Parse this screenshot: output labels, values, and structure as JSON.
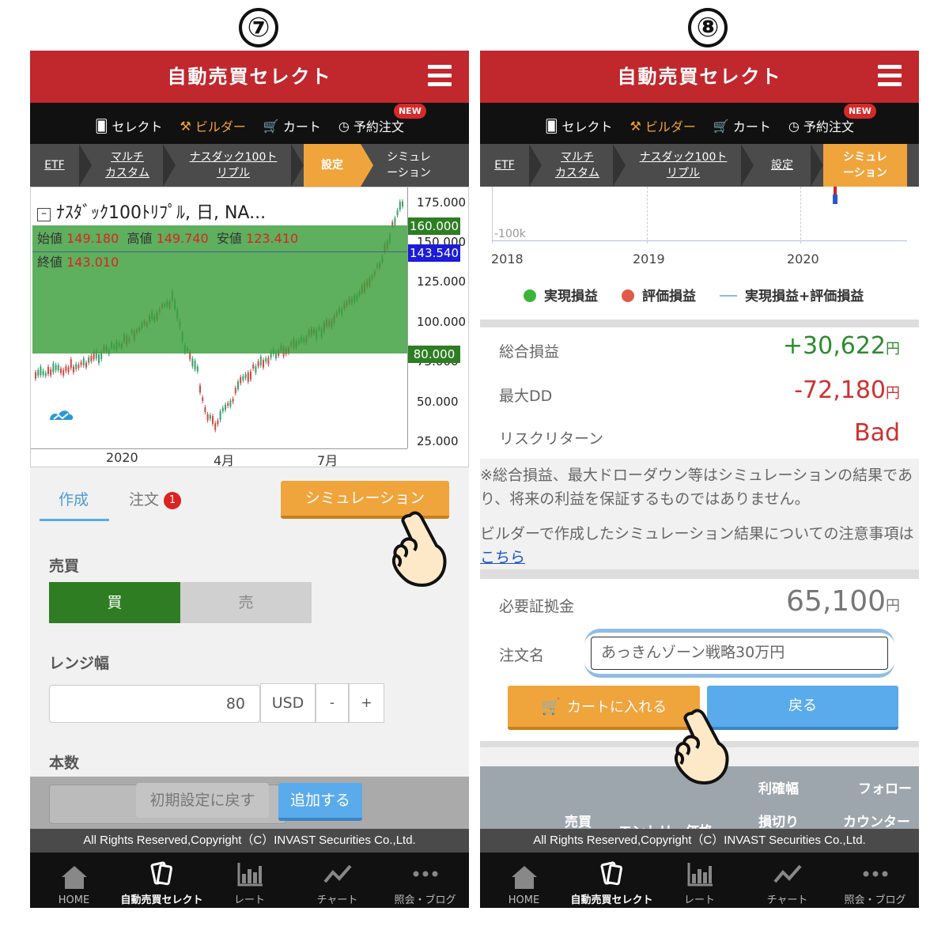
{
  "steps": {
    "left": "⑦",
    "right": "⑧"
  },
  "app": {
    "title": "自動売買セレクト",
    "tabs": [
      "セレクト",
      "ビルダー",
      "カート",
      "予約注文"
    ],
    "new_badge": "NEW",
    "copyright": "All Rights Reserved,Copyright（C）INVAST Securities Co.,Ltd.",
    "nav": [
      "HOME",
      "自動売買セレクト",
      "レート",
      "チャート",
      "照会・ブログ"
    ]
  },
  "breadcrumb": {
    "etf": "ETF",
    "multi": [
      "マルチ",
      "カスタム"
    ],
    "nasdaq": [
      "ナスダック100ト",
      "リプル"
    ],
    "settings": "設定",
    "simulation": [
      "シミュレ",
      "ーション"
    ]
  },
  "left": {
    "chart": {
      "title": "ﾅｽﾀﾞｯｸ100ﾄﾘﾌﾟﾙ, 日, NA...",
      "ohlc": {
        "open_label": "始値",
        "open": "149.180",
        "high_label": "高値",
        "high": "149.740",
        "low_label": "安値",
        "low": "123.410",
        "close_label": "終値",
        "close": "143.010"
      },
      "y_ticks": [
        "175.000",
        "150.000",
        "125.000",
        "100.000",
        "75.000",
        "50.000",
        "25.000"
      ],
      "tags": {
        "upper": "160.000",
        "price": "143.540",
        "lower": "80.000"
      },
      "x_ticks": [
        "2020",
        "4月",
        "7月"
      ],
      "colors": {
        "range": "#3a9d3a",
        "upper_tag": "#2e7d23",
        "price_tag": "#1b1bd8"
      }
    },
    "tab_create": "作成",
    "tab_order": "注文",
    "order_badge": "1",
    "sim_button": "シミュレーション",
    "trade_label": "売買",
    "buy": "買",
    "sell": "売",
    "range_label": "レンジ幅",
    "range_value": "80",
    "currency": "USD",
    "minus": "-",
    "plus": "+",
    "count_label": "本数",
    "reset_button": "初期設定に戻す",
    "add_button": "追加する"
  },
  "right": {
    "chart": {
      "y_tick": "-100k",
      "x_ticks": [
        "2018",
        "2019",
        "2020"
      ],
      "legend": [
        "実現損益",
        "評価損益",
        "実現損益+評価損益"
      ]
    },
    "rows": [
      {
        "label": "総合損益",
        "value": "+30,622",
        "unit": "円"
      },
      {
        "label": "最大DD",
        "value": "-72,180",
        "unit": "円"
      },
      {
        "label": "リスクリターン",
        "value": "Bad",
        "unit": ""
      }
    ],
    "disclaimer": "※総合損益、最大ドローダウン等はシミュレーションの結果であり、将来の利益を保証するものではありません。",
    "note_prefix": "ビルダーで作成したシミュレーション結果についての注意事項は",
    "note_link": "こちら",
    "margin_label": "必要証拠金",
    "margin_value": "65,100",
    "margin_unit": "円",
    "order_name_label": "注文名",
    "order_name_value": "あっきんゾーン戦略30万円",
    "cart_button": "カートに入れる",
    "back_button": "戻る",
    "table_headers": [
      "利確幅",
      "フォロー",
      "売買",
      "エントリー価格",
      "損切り",
      "カウンター"
    ]
  }
}
